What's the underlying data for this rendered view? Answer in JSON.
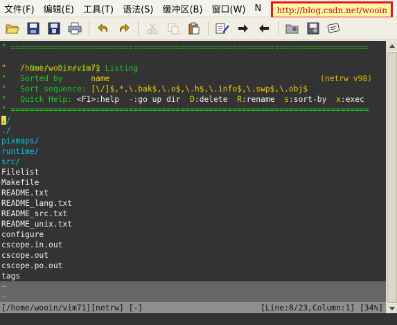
{
  "menubar": {
    "items": [
      "文件(F)",
      "编辑(E)",
      "工具(T)",
      "语法(S)",
      "缓冲区(B)",
      "窗口(W)",
      "N"
    ],
    "url": "http://blog.csdn.net/wooin"
  },
  "toolbar": {
    "buttons": [
      "open",
      "save",
      "save-all",
      "print",
      "undo",
      "redo",
      "cut",
      "copy",
      "paste",
      "find-replace",
      "next",
      "previous",
      "load-session",
      "save-session",
      "run-script"
    ]
  },
  "editor": {
    "separator_line": "\" ============================================================================",
    "header_title": "\" Netrw Directory Listing",
    "header_version": "(netrw v98)",
    "header_path": "\"   /home/wooin/vim71",
    "sorted_by_label": "\"   Sorted by      ",
    "sorted_by_value": "name",
    "sort_seq_label": "\"   Sort sequence: ",
    "sort_seq_value": "[\\/]$,*,\\.bak$,\\.o$,\\.h$,\\.info$,\\.swp$,\\.obj$",
    "quick_help_label": "\"   Quick Help: ",
    "quick_help": [
      {
        "key": "<F1>",
        "desc": ":help  "
      },
      {
        "key": "-",
        "desc": ":go up dir  "
      },
      {
        "key": "D",
        "desc": ":delete  "
      },
      {
        "key": "R",
        "desc": ":rename  "
      },
      {
        "key": "s",
        "desc": ":sort-by  "
      },
      {
        "key": "x",
        "desc": ":exec"
      }
    ],
    "cursor_char": ".",
    "entries": [
      {
        "name": "./",
        "type": "dir-cursor"
      },
      {
        "name": "./",
        "type": "plain"
      },
      {
        "name": "pixmaps/",
        "type": "dir"
      },
      {
        "name": "runtime/",
        "type": "dir"
      },
      {
        "name": "src/",
        "type": "dir"
      },
      {
        "name": "Filelist",
        "type": "file"
      },
      {
        "name": "Makefile",
        "type": "file"
      },
      {
        "name": "README.txt",
        "type": "file"
      },
      {
        "name": "README_lang.txt",
        "type": "file"
      },
      {
        "name": "README_src.txt",
        "type": "file"
      },
      {
        "name": "README_unix.txt",
        "type": "file"
      },
      {
        "name": "configure",
        "type": "file"
      },
      {
        "name": "cscope.in.out",
        "type": "file"
      },
      {
        "name": "cscope.out",
        "type": "file"
      },
      {
        "name": "cscope.po.out",
        "type": "file"
      },
      {
        "name": "tags",
        "type": "file"
      }
    ],
    "tilde": "~"
  },
  "statusline": {
    "left": "[/home/wooin/vim71][netrw] [-]",
    "right": "[Line:8/23,Column:1] [34%]"
  },
  "colors": {
    "background": "#333333",
    "comment": "#1EC81E",
    "path": "#E8B800",
    "directory": "#00C8E8",
    "file": "#F0F0F0",
    "statusline": "#8E8E8E",
    "url_border": "#E8141C"
  }
}
